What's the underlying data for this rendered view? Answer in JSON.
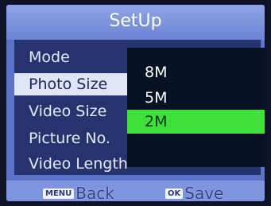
{
  "title": "SetUp",
  "menu": [
    {
      "label": "Mode"
    },
    {
      "label": "Photo Size"
    },
    {
      "label": "Video Size"
    },
    {
      "label": "Picture No."
    },
    {
      "label": "Video Length"
    }
  ],
  "submenu": [
    {
      "label": "8M"
    },
    {
      "label": "5M"
    },
    {
      "label": "2M"
    }
  ],
  "footer": {
    "back_key": "MENU",
    "back_label": "Back",
    "save_key": "OK",
    "save_label": "Save"
  }
}
